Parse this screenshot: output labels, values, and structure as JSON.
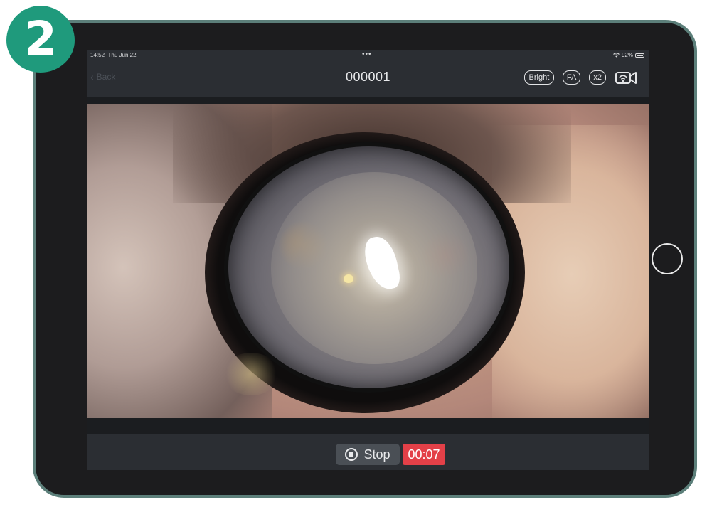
{
  "badge": {
    "number": "2"
  },
  "status_bar": {
    "time": "14:52",
    "date": "Thu Jun 22",
    "dots": "•••",
    "wifi_icon": "wifi-icon",
    "battery": "92%"
  },
  "nav": {
    "back_label": "Back",
    "title": "000001",
    "bright_label": "Bright",
    "fa_label": "FA",
    "zoom_label": "x2",
    "camera_icon": "wifi-camera-icon"
  },
  "recording": {
    "stop_label": "Stop",
    "timer": "00:07"
  },
  "colors": {
    "badge": "#1f9a7c",
    "timer_bg": "#e34048",
    "bar_bg": "#2b2e33",
    "tablet_frame": "#5c7f7a"
  }
}
